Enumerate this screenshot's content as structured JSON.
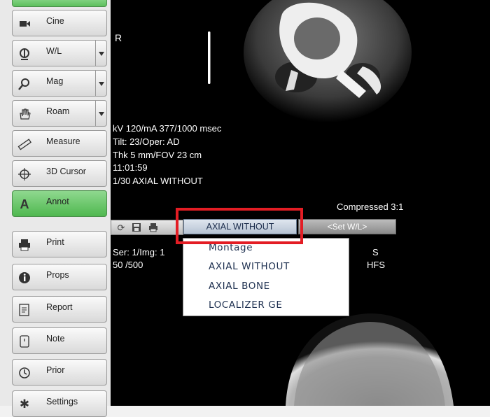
{
  "sidebar": {
    "items": [
      {
        "label": "Cine",
        "icon": "camera-icon"
      },
      {
        "label": "W/L",
        "icon": "window-level-icon"
      },
      {
        "label": "Mag",
        "icon": "magnify-icon"
      },
      {
        "label": "Roam",
        "icon": "hand-icon"
      },
      {
        "label": "Measure",
        "icon": "ruler-icon"
      },
      {
        "label": "3D Cursor",
        "icon": "crosshair-icon"
      },
      {
        "label": "Annot",
        "icon": "annotation-icon"
      },
      {
        "label": "Print",
        "icon": "printer-icon"
      },
      {
        "label": "Props",
        "icon": "info-icon"
      },
      {
        "label": "Report",
        "icon": "report-icon"
      },
      {
        "label": "Note",
        "icon": "note-icon"
      },
      {
        "label": "Prior",
        "icon": "history-icon"
      },
      {
        "label": "Settings",
        "icon": "gear-icon"
      }
    ]
  },
  "top_viewport": {
    "orientation": "R",
    "lines": [
      "kV 120/mA 377/1000 msec",
      "Tilt: 23/Oper: AD",
      "Thk 5 mm/FOV 23 cm",
      "11:01:59",
      "1/30 AXIAL  WITHOUT"
    ],
    "compressed": "Compressed 3:1"
  },
  "toolbar": {
    "series_select": "AXIAL  WITHOUT",
    "set_wl": "<Set W/L>"
  },
  "dropdown": {
    "options": [
      "Montage",
      "AXIAL  WITHOUT",
      "AXIAL BONE",
      "LOCALIZER GE"
    ]
  },
  "bottom_viewport": {
    "ser_img": "Ser: 1/Img: 1",
    "wl": "50   /500",
    "orientation": "S",
    "position": "HFS"
  },
  "colors": {
    "active_button": "#5cc05c",
    "highlight_box": "#e31d24"
  }
}
